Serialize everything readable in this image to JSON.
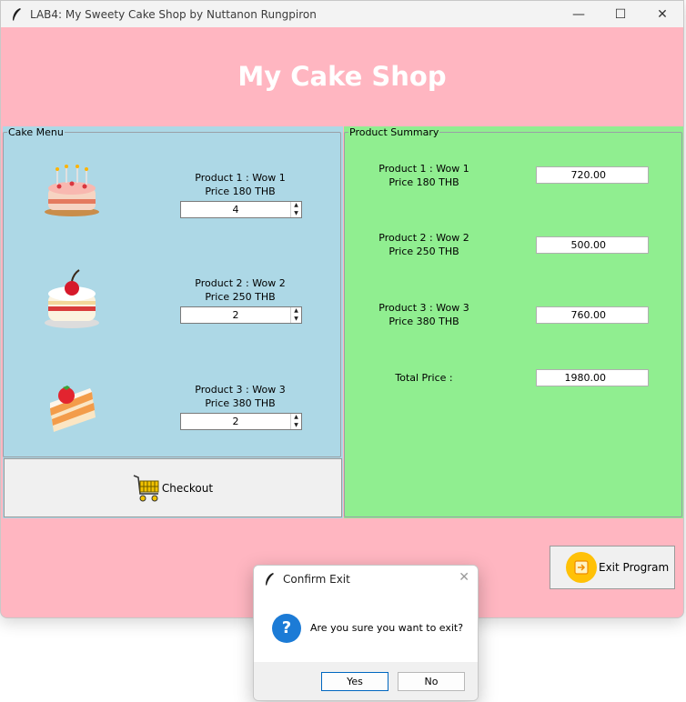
{
  "window": {
    "title": "LAB4: My Sweety Cake Shop by Nuttanon Rungpiron",
    "minimize_glyph": "—",
    "maximize_glyph": "☐",
    "close_glyph": "✕"
  },
  "header": {
    "title": "My Cake Shop"
  },
  "cake_menu": {
    "legend": "Cake Menu",
    "products": [
      {
        "name": "Product 1 : Wow 1",
        "price": "Price 180 THB",
        "quantity": "4",
        "icon": "cake-candles-icon"
      },
      {
        "name": "Product 2 : Wow 2",
        "price": "Price 250 THB",
        "quantity": "2",
        "icon": "cake-cherry-icon"
      },
      {
        "name": "Product 3 : Wow 3",
        "price": "Price 380 THB",
        "quantity": "2",
        "icon": "cake-slice-icon"
      }
    ],
    "checkout_label": "Checkout"
  },
  "summary": {
    "legend": "Product Summary",
    "items": [
      {
        "name": "Product 1 : Wow 1",
        "price": "Price 180 THB",
        "total": "720.00"
      },
      {
        "name": "Product 2 : Wow 2",
        "price": "Price 250 THB",
        "total": "500.00"
      },
      {
        "name": "Product 3 : Wow 3",
        "price": "Price 380 THB",
        "total": "760.00"
      }
    ],
    "total_label": "Total Price :",
    "total_value": "1980.00"
  },
  "footer": {
    "exit_label": "Exit Program"
  },
  "dialog": {
    "title": "Confirm Exit",
    "close_glyph": "✕",
    "icon_glyph": "?",
    "message": "Are you sure you want to exit?",
    "yes_label": "Yes",
    "no_label": "No"
  },
  "colors": {
    "pink_background": "#ffb6c1",
    "light_blue_panel": "#add8e6",
    "light_green_panel": "#90ee90",
    "exit_icon": "#ffc107",
    "question_icon": "#1c7bd6"
  }
}
